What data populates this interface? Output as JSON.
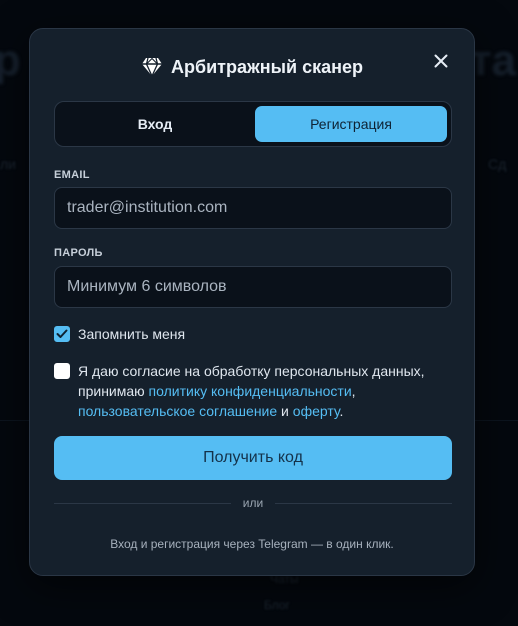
{
  "modal": {
    "title": "Арбитражный сканер",
    "tabs": [
      {
        "label": "Вход",
        "active": false
      },
      {
        "label": "Регистрация",
        "active": true
      }
    ],
    "email": {
      "label": "EMAIL",
      "placeholder": "trader@institution.com",
      "value": ""
    },
    "password": {
      "label": "ПАРОЛЬ",
      "placeholder": "Минимум 6 символов",
      "value": ""
    },
    "remember": {
      "label": "Запомнить меня",
      "checked": true
    },
    "consent": {
      "checked": false,
      "text_before": "Я даю согласие на обработку персональных данных, принимаю ",
      "privacy_link": "политику конфиденциальности",
      "comma": ",",
      "terms_link": "пользовательское соглашение",
      "and": " и ",
      "offer_link": "оферту",
      "period": "."
    },
    "submit_label": "Получить код",
    "divider_label": "или",
    "footnote": "Вход и регистрация через Telegram — в один клик."
  },
  "colors": {
    "accent": "#55bdf3",
    "modal_bg": "#15202c",
    "page_bg": "#04080e",
    "input_bg": "#0a111a"
  },
  "icons": {
    "logo": "diamond-icon",
    "close": "close-icon",
    "check": "checkmark-icon"
  }
}
